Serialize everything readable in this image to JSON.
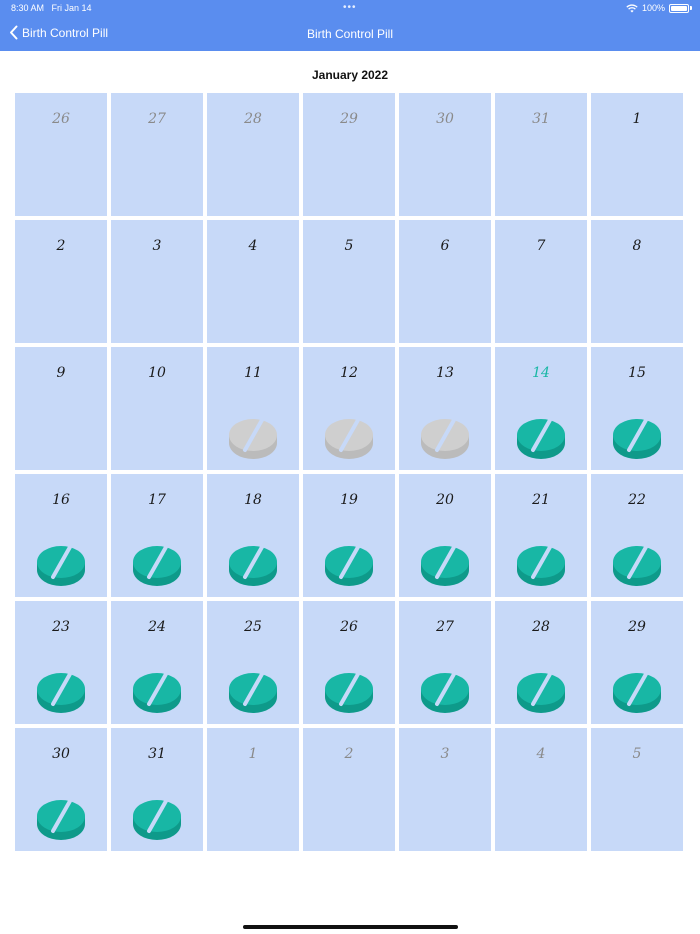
{
  "status_bar": {
    "time": "8:30 AM",
    "date": "Fri Jan 14",
    "dots": "•••",
    "battery": "100%"
  },
  "nav": {
    "back_label": "Birth Control Pill",
    "title": "Birth Control Pill"
  },
  "calendar": {
    "month": "January 2022",
    "days": [
      {
        "label": "26",
        "muted": true,
        "pill": null
      },
      {
        "label": "27",
        "muted": true,
        "pill": null
      },
      {
        "label": "28",
        "muted": true,
        "pill": null
      },
      {
        "label": "29",
        "muted": true,
        "pill": null
      },
      {
        "label": "30",
        "muted": true,
        "pill": null
      },
      {
        "label": "31",
        "muted": true,
        "pill": null
      },
      {
        "label": "1",
        "pill": null
      },
      {
        "label": "2",
        "pill": null
      },
      {
        "label": "3",
        "pill": null
      },
      {
        "label": "4",
        "pill": null
      },
      {
        "label": "5",
        "pill": null
      },
      {
        "label": "6",
        "pill": null
      },
      {
        "label": "7",
        "pill": null
      },
      {
        "label": "8",
        "pill": null
      },
      {
        "label": "9",
        "pill": null
      },
      {
        "label": "10",
        "pill": null
      },
      {
        "label": "11",
        "pill": "gray"
      },
      {
        "label": "12",
        "pill": "gray"
      },
      {
        "label": "13",
        "pill": "gray"
      },
      {
        "label": "14",
        "today": true,
        "pill": "green"
      },
      {
        "label": "15",
        "pill": "green"
      },
      {
        "label": "16",
        "pill": "green"
      },
      {
        "label": "17",
        "pill": "green"
      },
      {
        "label": "18",
        "pill": "green"
      },
      {
        "label": "19",
        "pill": "green"
      },
      {
        "label": "20",
        "pill": "green"
      },
      {
        "label": "21",
        "pill": "green"
      },
      {
        "label": "22",
        "pill": "green"
      },
      {
        "label": "23",
        "pill": "green"
      },
      {
        "label": "24",
        "pill": "green"
      },
      {
        "label": "25",
        "pill": "green"
      },
      {
        "label": "26",
        "pill": "green"
      },
      {
        "label": "27",
        "pill": "green"
      },
      {
        "label": "28",
        "pill": "green"
      },
      {
        "label": "29",
        "pill": "green"
      },
      {
        "label": "30",
        "pill": "green"
      },
      {
        "label": "31",
        "pill": "green"
      },
      {
        "label": "1",
        "muted": true,
        "pill": null
      },
      {
        "label": "2",
        "muted": true,
        "pill": null
      },
      {
        "label": "3",
        "muted": true,
        "pill": null
      },
      {
        "label": "4",
        "muted": true,
        "pill": null
      },
      {
        "label": "5",
        "muted": true,
        "pill": null
      }
    ]
  },
  "icons": {
    "back": "chevron-left-icon",
    "wifi": "wifi-icon",
    "battery": "battery-icon",
    "pill": "pill-icon"
  },
  "colors": {
    "nav_bar": "#5a8def",
    "cell_bg": "#c7d9f8",
    "pill_taken": "#18b7a5",
    "pill_taken_dark": "#0e9a8a",
    "pill_missed": "#cfcfcf",
    "pill_missed_dark": "#bbbbbb",
    "today_text": "#18b7a5"
  }
}
